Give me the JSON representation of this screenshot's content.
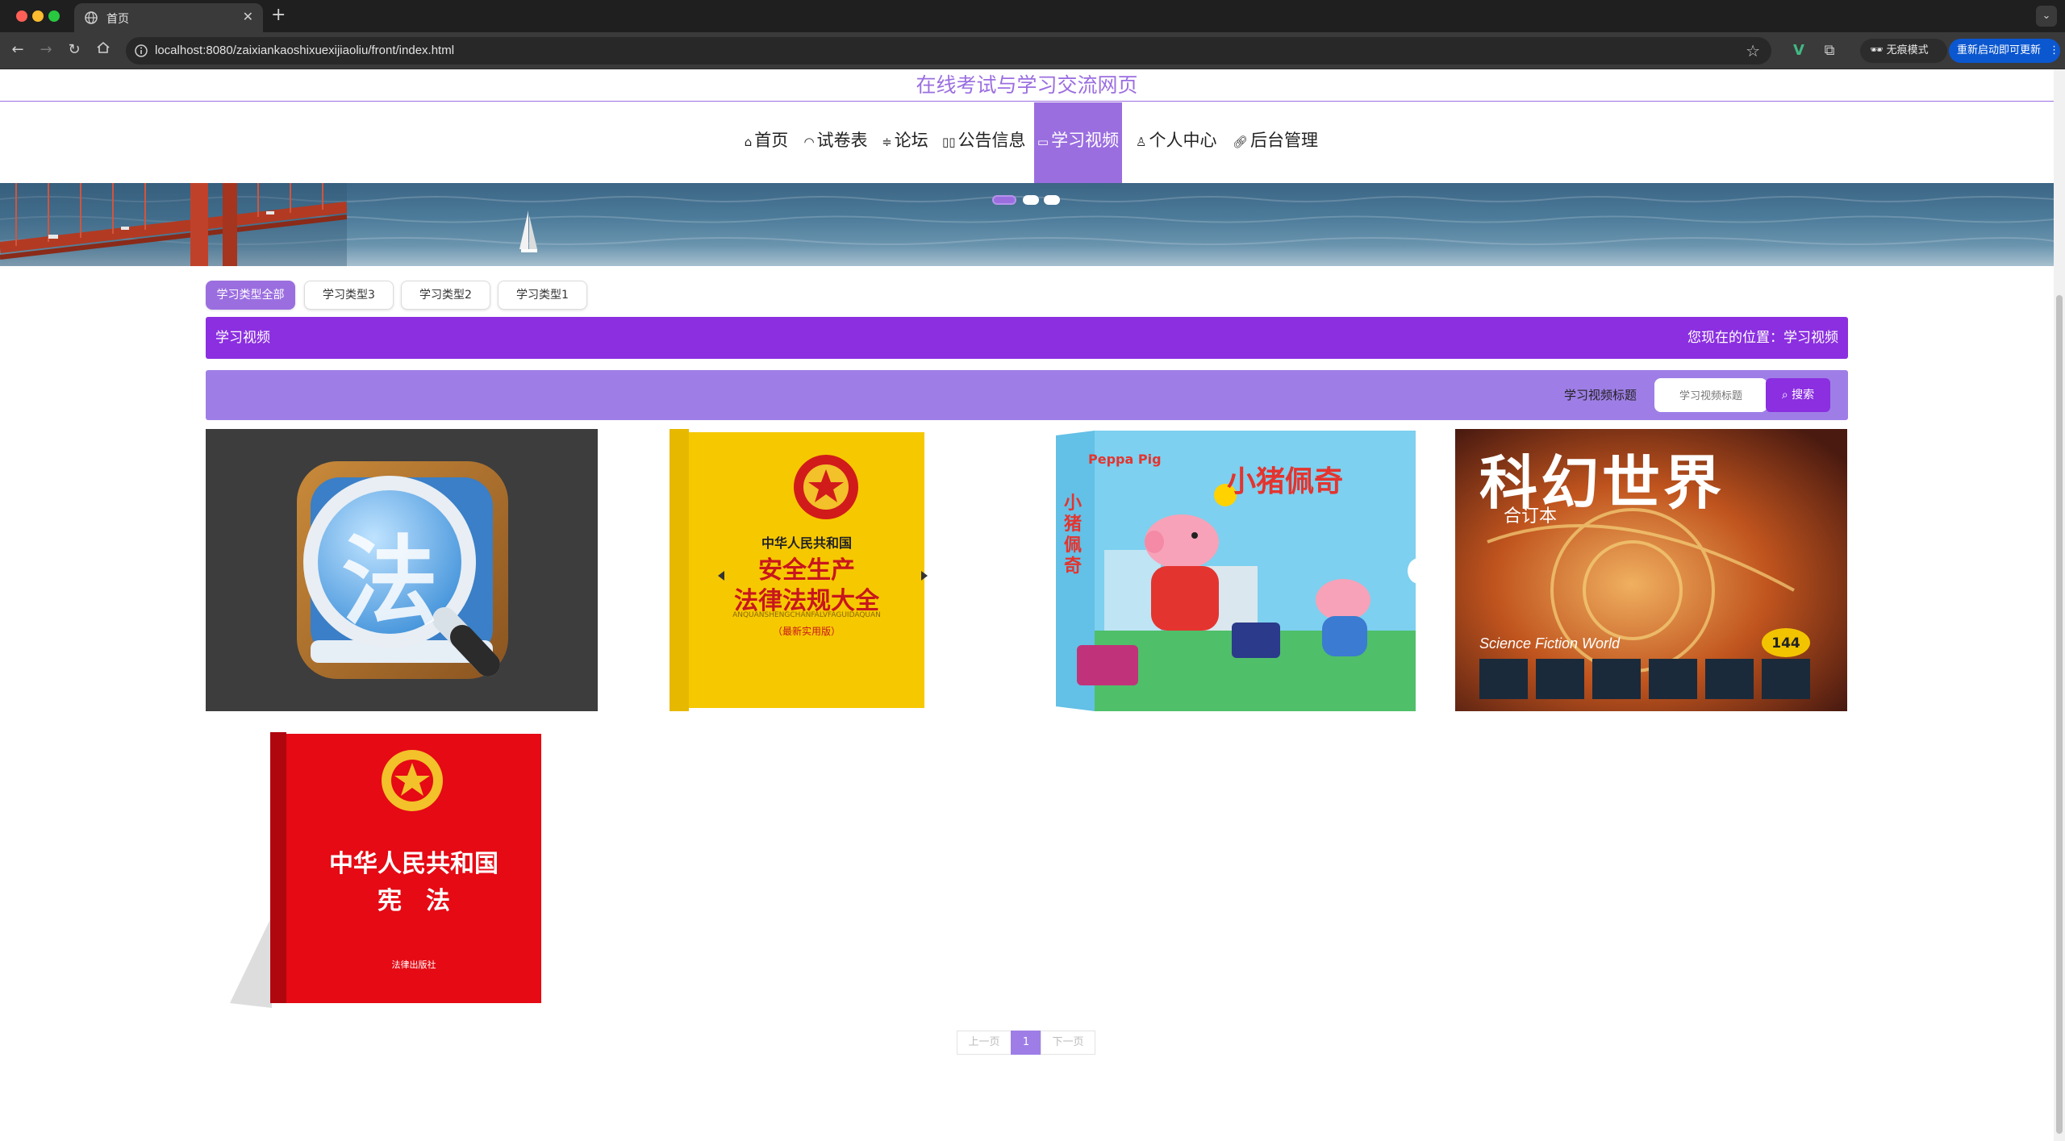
{
  "browser": {
    "tab_title": "首页",
    "url": "localhost:8080/zaixiankaoshixuexijiaoliu/front/index.html",
    "incognito_label": "无痕模式",
    "relaunch_label": "重新启动即可更新"
  },
  "site": {
    "title": "在线考试与学习交流网页"
  },
  "nav": {
    "items": [
      {
        "label": "首页",
        "icon": "home-icon"
      },
      {
        "label": "试卷表",
        "icon": "paper-icon"
      },
      {
        "label": "论坛",
        "icon": "filter-icon"
      },
      {
        "label": "公告信息",
        "icon": "notice-icon"
      },
      {
        "label": "学习视频",
        "icon": "video-icon",
        "active": true
      },
      {
        "label": "个人中心",
        "icon": "user-icon"
      },
      {
        "label": "后台管理",
        "icon": "link-icon"
      }
    ]
  },
  "filters": [
    "学习类型全部",
    "学习类型3",
    "学习类型2",
    "学习类型1"
  ],
  "section": {
    "title": "学习视频",
    "location": "您现在的位置：学习视频"
  },
  "search": {
    "label": "学习视频标题",
    "placeholder": "学习视频标题",
    "button": "搜索"
  },
  "cards": [
    {
      "image": "law-search-app-icon",
      "text": "法"
    },
    {
      "image": "safety-production-law-book",
      "header": "中华人民共和国",
      "line1": "安全生产",
      "line2": "法律法规大全",
      "pinyin": "ANQUANSHENGCHANFALVFAGUIDAQUAN",
      "edition": "（最新实用版）"
    },
    {
      "image": "peppa-pig-book-box",
      "logo": "Peppa Pig",
      "title": "小猪佩奇",
      "side": "小猪佩奇"
    },
    {
      "image": "science-fiction-world-magazine",
      "title": "科幻世界",
      "subtitle": "合订本",
      "english": "Science Fiction World",
      "badge": "144"
    },
    {
      "image": "constitution-red-book",
      "line1": "中华人民共和国",
      "line2": "宪　法",
      "publisher": "法律出版社"
    }
  ],
  "pagination": {
    "prev": "上一页",
    "current": "1",
    "next": "下一页"
  },
  "colors": {
    "accent": "#9b6ee0",
    "section_bar": "#8b2fe0",
    "search_bar": "#9e7ee6"
  }
}
